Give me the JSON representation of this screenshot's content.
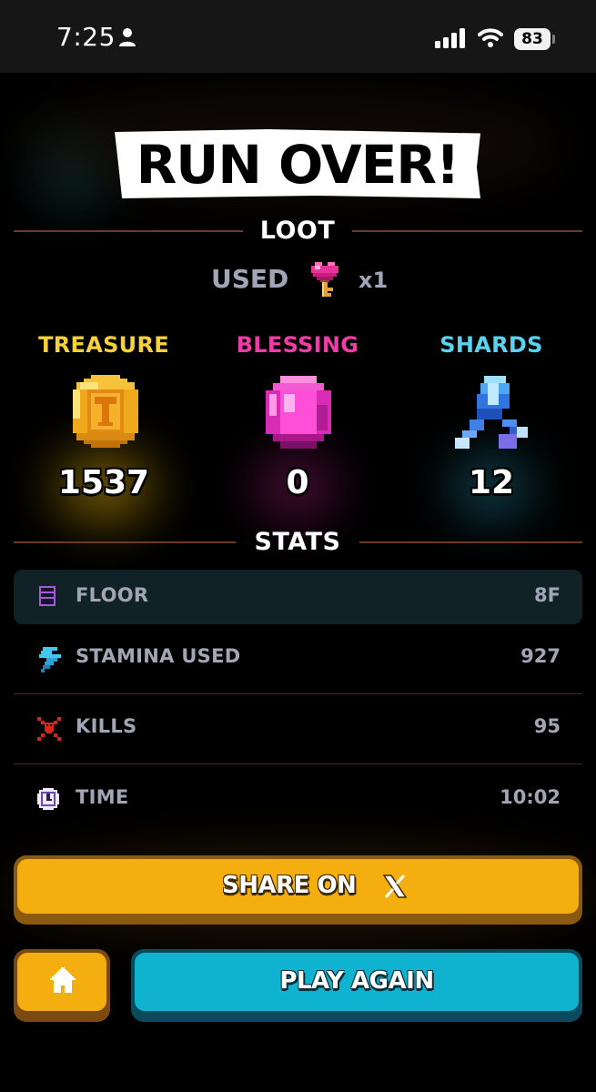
{
  "status_bar": {
    "time": "7:25",
    "battery": "83"
  },
  "title": "RUN OVER!",
  "loot": {
    "heading": "LOOT",
    "used_label": "USED",
    "used_item_icon": "pink-heart-key-icon",
    "used_count": "x1",
    "items": [
      {
        "label": "TREASURE",
        "value": "1537",
        "icon": "gold-coin-icon",
        "color": "#f7d13a"
      },
      {
        "label": "BLESSING",
        "value": "0",
        "icon": "pink-gem-icon",
        "color": "#f03ca6"
      },
      {
        "label": "SHARDS",
        "value": "12",
        "icon": "blue-crystal-shard-icon",
        "color": "#5cd3ee"
      }
    ]
  },
  "stats": {
    "heading": "STATS",
    "rows": [
      {
        "label": "FLOOR",
        "value": "8F",
        "icon": "floor-stack-icon"
      },
      {
        "label": "STAMINA USED",
        "value": "927",
        "icon": "lightning-bolt-icon"
      },
      {
        "label": "KILLS",
        "value": "95",
        "icon": "skull-crossbones-icon"
      },
      {
        "label": "TIME",
        "value": "10:02",
        "icon": "clock-icon"
      }
    ]
  },
  "buttons": {
    "share_label": "SHARE ON",
    "share_icon": "x-logo-icon",
    "home_icon": "home-icon",
    "play_again_label": "PLAY AGAIN"
  },
  "colors": {
    "accent_yellow": "#f5ae0f",
    "accent_cyan": "#0fb3cf",
    "stat_text": "#a2a5b6",
    "divider": "#6b3a28"
  }
}
